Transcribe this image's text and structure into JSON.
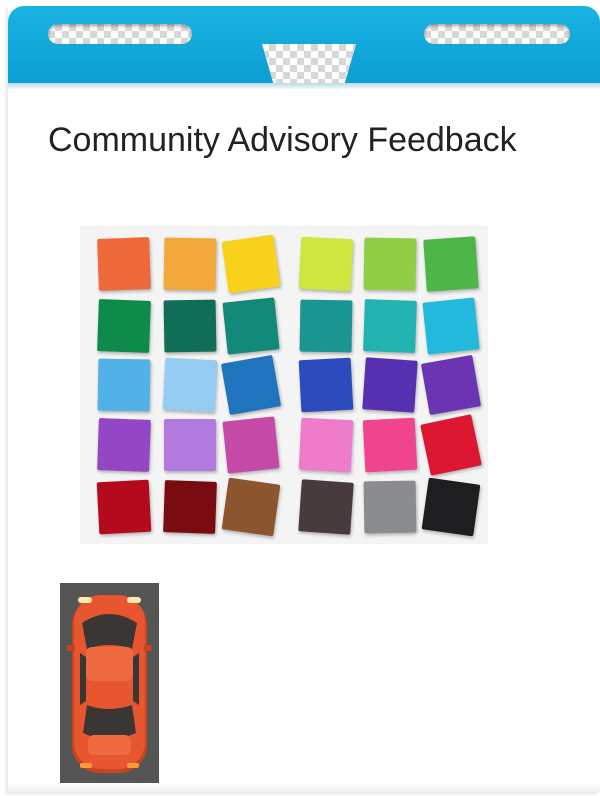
{
  "title": "Community Advisory Feedback",
  "colors": {
    "header_blue": "#13ace0",
    "board_background": "#ffffff",
    "car_background": "#555555",
    "car_body": "#e8562f"
  },
  "icons": {
    "car": "car-top-view-icon",
    "swatches": "color-swatch-grid"
  },
  "swatches": [
    [
      "#ef6a3a",
      "#f2a93b",
      "#f8d21a",
      "#cde640",
      "#8fce45",
      "#4cb649"
    ],
    [
      "#0e8a4a",
      "#0f6e55",
      "#138a79",
      "#1b9591",
      "#22b3b0",
      "#23b9dc"
    ],
    [
      "#52b1e6",
      "#94cdf1",
      "#1f74bd",
      "#2d4bbd",
      "#5530b0",
      "#6a34b2"
    ],
    [
      "#9347c4",
      "#b27adf",
      "#c54aa8",
      "#ef7bcb",
      "#f0458e",
      "#db1732"
    ],
    [
      "#b50a1c",
      "#7a0b11",
      "#8b5530",
      "#473b3d",
      "#8b8c90",
      "#1e1d20"
    ]
  ]
}
